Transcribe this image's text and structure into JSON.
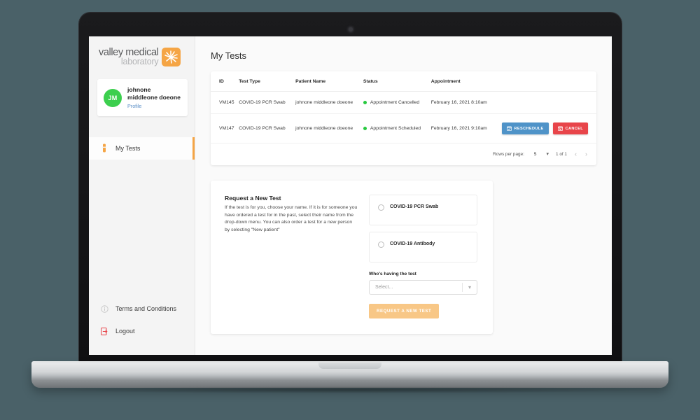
{
  "brand": {
    "line1": "valley medical",
    "line2": "laboratory",
    "mark_icon": "sunburst-icon",
    "mark_color": "#f5a545"
  },
  "sidebar": {
    "profile": {
      "initials": "JM",
      "first_name": "johnone",
      "last_name": "middleone doeone",
      "link_label": "Profile",
      "avatar_color": "#3ccf4e"
    },
    "nav_main": [
      {
        "label": "My Tests",
        "icon": "test-tube-icon",
        "active": true
      }
    ],
    "nav_bottom": [
      {
        "label": "Terms and Conditions",
        "icon": "info-icon",
        "active": false
      },
      {
        "label": "Logout",
        "icon": "logout-icon",
        "active": false
      }
    ]
  },
  "main": {
    "page_title": "My Tests",
    "table": {
      "columns": [
        "ID",
        "Test Type",
        "Patient Name",
        "Status",
        "Appointment"
      ],
      "rows": [
        {
          "id": "VM145",
          "test_type": "COVID-19 PCR Swab",
          "patient_name": "johnone middleone doeone",
          "status": "Appointment Cancelled",
          "status_color": "#27c93f",
          "appointment": "February 16, 2021 8:10am",
          "actions": []
        },
        {
          "id": "VM147",
          "test_type": "COVID-19 PCR Swab",
          "patient_name": "johnone middleone doeone",
          "status": "Appointment Scheduled",
          "status_color": "#27c93f",
          "appointment": "February 16, 2021 9:10am",
          "actions": [
            {
              "label": "RESCHEDULE",
              "icon": "calendar-check-icon",
              "color": "#4f93c8"
            },
            {
              "label": "CANCEL",
              "icon": "calendar-x-icon",
              "color": "#e8454a"
            }
          ]
        }
      ]
    },
    "pagination": {
      "rows_per_page_label": "Rows per page:",
      "rows_per_page_value": "5",
      "page_info": "1 of 1",
      "prev_icon": "chevron-left-icon",
      "next_icon": "chevron-right-icon"
    },
    "request": {
      "title": "Request a New Test",
      "description": "If the test is for you, choose your name. If it is for someone you have ordered a test for in the past, select their name from the drop-down menu. You can also order a test for a new person by selecting \"New patient\"",
      "test_options": [
        {
          "label": "COVID-19 PCR Swab",
          "selected": false
        },
        {
          "label": "COVID-19 Antibody",
          "selected": false
        }
      ],
      "select_label": "Who's having the test",
      "select_placeholder": "Select...",
      "submit_label": "REQUEST A NEW TEST",
      "submit_color": "#f8c786"
    }
  }
}
